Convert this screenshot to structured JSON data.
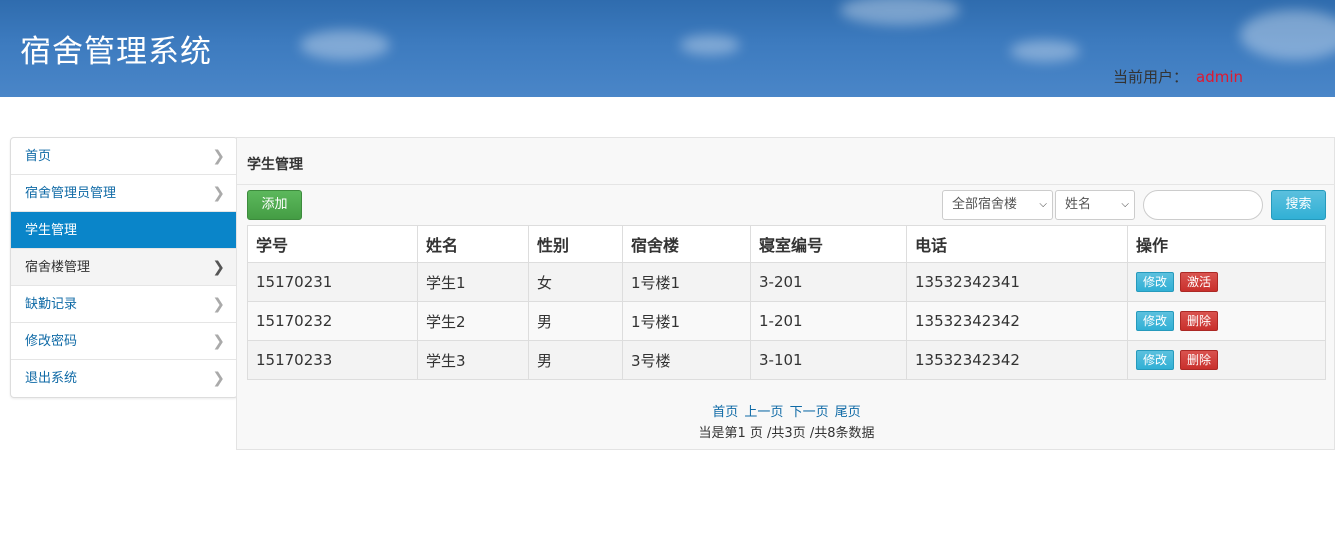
{
  "header": {
    "title": "宿舍管理系统",
    "user_label": "当前用户：",
    "user_name": "admin"
  },
  "sidebar": {
    "items": [
      {
        "label": "首页"
      },
      {
        "label": "宿舍管理员管理"
      },
      {
        "label": "学生管理",
        "active": true
      },
      {
        "label": "宿舍楼管理"
      },
      {
        "label": "缺勤记录"
      },
      {
        "label": "修改密码"
      },
      {
        "label": "退出系统"
      }
    ]
  },
  "main": {
    "title": "学生管理",
    "add_label": "添加",
    "building_filter": "全部宿舍楼",
    "field_filter": "姓名",
    "search_placeholder": "",
    "search_label": "搜索",
    "table": {
      "headers": [
        "学号",
        "姓名",
        "性别",
        "宿舍楼",
        "寝室编号",
        "电话",
        "操作"
      ],
      "rows": [
        {
          "cells": [
            "15170231",
            "学生1",
            "女",
            "1号楼1",
            "3-201",
            "13532342341"
          ],
          "edit": "修改",
          "action": "激活"
        },
        {
          "cells": [
            "15170232",
            "学生2",
            "男",
            "1号楼1",
            "1-201",
            "13532342342"
          ],
          "edit": "修改",
          "action": "删除"
        },
        {
          "cells": [
            "15170233",
            "学生3",
            "男",
            "3号楼",
            "3-101",
            "13532342342"
          ],
          "edit": "修改",
          "action": "删除"
        }
      ]
    },
    "pagination": {
      "first": "首页",
      "prev": "上一页",
      "next": "下一页",
      "last": "尾页",
      "status": "当是第1 页 /共3页  /共8条数据"
    }
  },
  "colors": {
    "header_bg": "#3d7bbf",
    "active_nav": "#0a85c9",
    "user_name": "#e0182f",
    "add_button": "#5cb85c",
    "info_button": "#5bc0de",
    "danger_button": "#d9534f"
  }
}
